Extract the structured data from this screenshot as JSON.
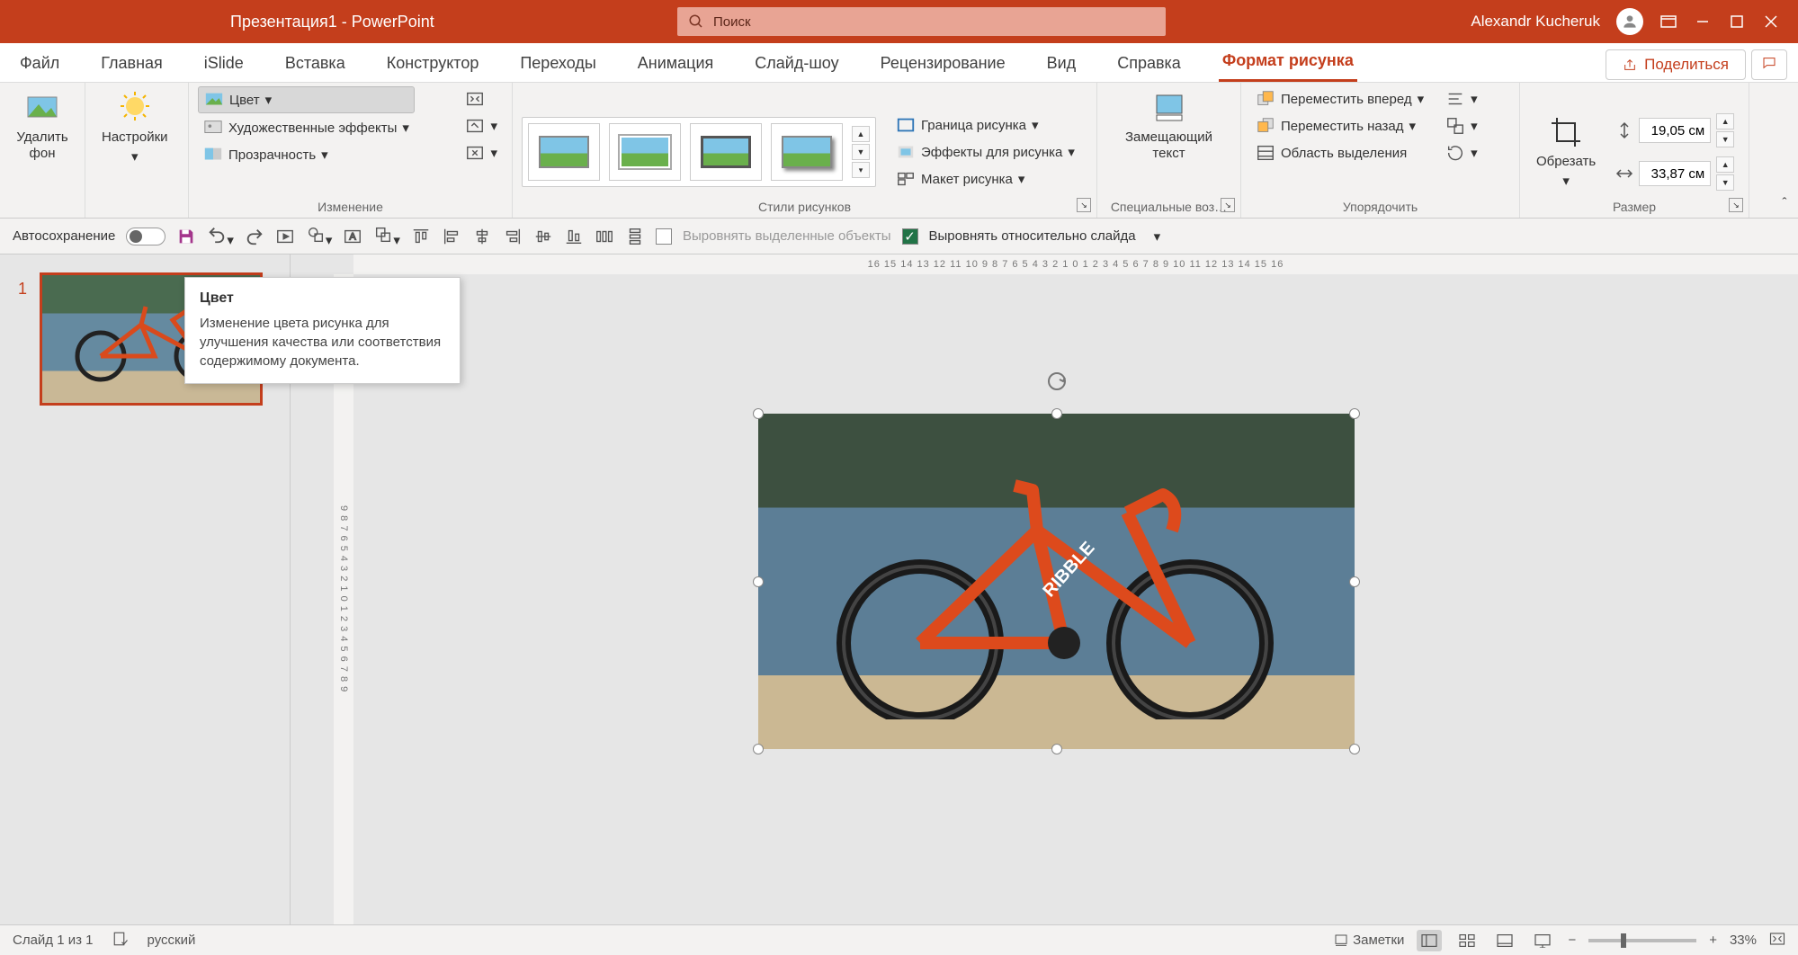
{
  "titlebar": {
    "title": "Презентация1 - PowerPoint",
    "search_placeholder": "Поиск",
    "user": "Alexandr Kucheruk"
  },
  "tabs": [
    "Файл",
    "Главная",
    "iSlide",
    "Вставка",
    "Конструктор",
    "Переходы",
    "Анимация",
    "Слайд-шоу",
    "Рецензирование",
    "Вид",
    "Справка",
    "Формат рисунка"
  ],
  "active_tab": "Формат рисунка",
  "share": "Поделиться",
  "ribbon": {
    "remove_bg": "Удалить фон",
    "adjust": "Настройки",
    "color": "Цвет",
    "effects": "Художественные эффекты",
    "transparency": "Прозрачность",
    "group_adjust": "Изменение",
    "border": "Граница рисунка",
    "pic_effects": "Эффекты для рисунка",
    "layout": "Макет рисунка",
    "group_styles": "Стили рисунков",
    "alt_text": "Замещающий текст",
    "group_alt": "Специальные воз…",
    "forward": "Переместить вперед",
    "backward": "Переместить назад",
    "selection": "Область выделения",
    "group_arrange": "Упорядочить",
    "crop": "Обрезать",
    "height": "19,05 см",
    "width": "33,87 см",
    "group_size": "Размер"
  },
  "qat": {
    "autosave": "Автосохранение",
    "align_sel": "Выровнять выделенные объекты",
    "align_slide": "Выровнять относительно слайда"
  },
  "ruler_h": "16 15 14 13 12 11 10 9 8 7 6 5 4 3 2 1 0 1 2 3 4 5 6 7 8 9 10 11 12 13 14 15 16",
  "ruler_v": "9 8 7 6 5 4 3 2 1 0 1 2 3 4 5 6 7 8 9",
  "tooltip": {
    "title": "Цвет",
    "body": "Изменение цвета рисунка для улучшения качества или соответствия содержимому документа."
  },
  "slide_num": "1",
  "status": {
    "slide": "Слайд 1 из 1",
    "lang": "русский",
    "notes": "Заметки",
    "zoom": "33%"
  }
}
